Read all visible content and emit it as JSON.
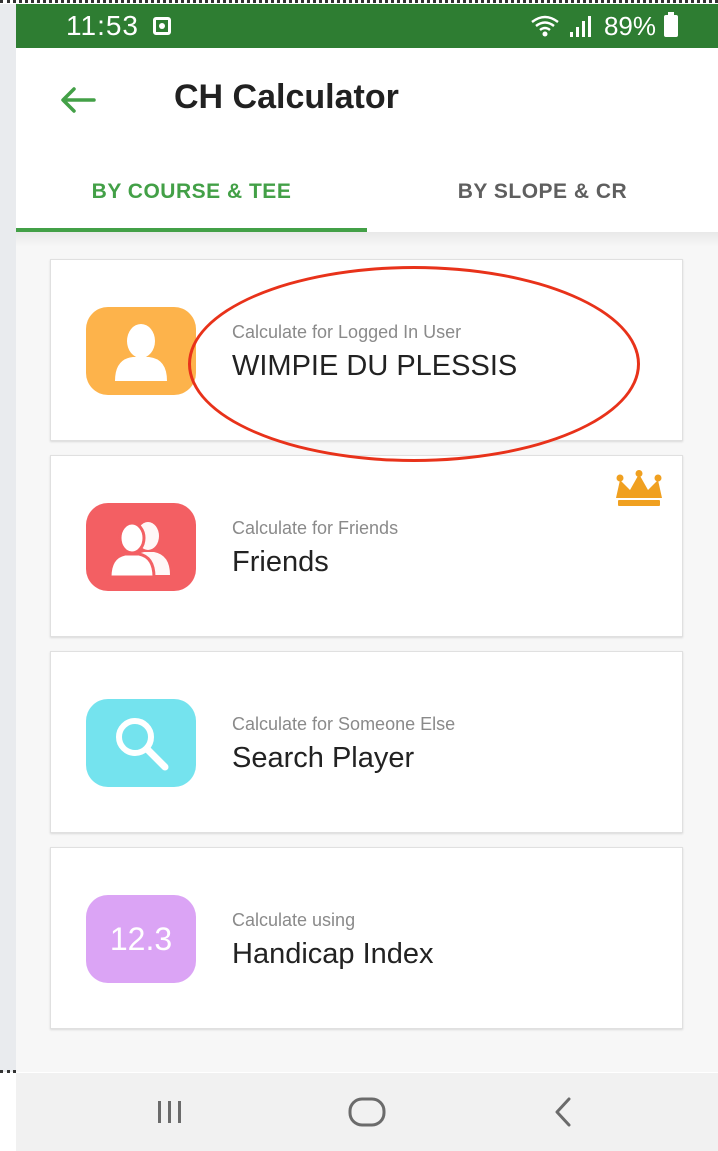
{
  "status_bar": {
    "time": "11:53",
    "battery": "89%"
  },
  "app_bar": {
    "title": "CH Calculator"
  },
  "tabs": [
    {
      "label": "BY COURSE & TEE",
      "active": true
    },
    {
      "label": "BY SLOPE & CR",
      "active": false
    }
  ],
  "cards": [
    {
      "subtitle": "Calculate for Logged In User",
      "title": "WIMPIE DU PLESSIS",
      "icon": "user-icon",
      "icon_color": "#fdb34b"
    },
    {
      "subtitle": "Calculate for Friends",
      "title": "Friends",
      "icon": "friends-icon",
      "icon_color": "#f35f63",
      "badge_icon": "crown-icon"
    },
    {
      "subtitle": "Calculate for Someone Else",
      "title": "Search Player",
      "icon": "search-icon",
      "icon_color": "#74e3ee"
    },
    {
      "subtitle": "Calculate using",
      "title": "Handicap Index",
      "icon_text": "12.3",
      "icon_color": "#dba4f5"
    }
  ],
  "colors": {
    "status_bar": "#2e7d32",
    "accent_green": "#43a047",
    "annotation_red": "#e8321a",
    "crown_gold": "#f0a020"
  },
  "nav_bar": {
    "buttons": [
      "recent-apps-icon",
      "home-icon",
      "back-icon"
    ]
  }
}
